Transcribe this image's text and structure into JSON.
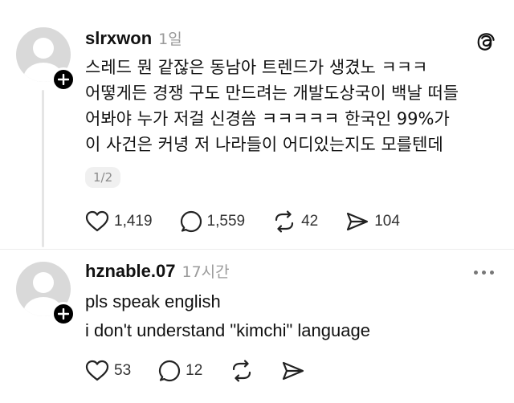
{
  "posts": [
    {
      "username": "slrxwon",
      "time": "1일",
      "lines": [
        "스레드 뭔 같잖은 동남아 트렌드가 생겼노 ㅋㅋㅋ",
        "어떻게든 경쟁 구도 만드려는 개발도상국이 백날 떠들",
        "어봐야 누가 저걸 신경씀 ㅋㅋㅋㅋㅋ 한국인 99%가",
        "이 사건은 커녕 저 나라들이 어디있는지도 모를텐데"
      ],
      "page_indicator": "1/2",
      "likes": "1,419",
      "comments": "1,559",
      "reposts": "42",
      "shares": "104"
    },
    {
      "username": "hznable.07",
      "time": "17시간",
      "lines": [
        "pls speak english",
        "i don't understand \"kimchi\" language"
      ],
      "likes": "53",
      "comments": "12"
    }
  ],
  "icons": {
    "avatar": "default-avatar",
    "follow": "plus-icon",
    "brand": "threads-icon",
    "more": "more-icon",
    "like": "heart-icon",
    "comment": "comment-icon",
    "repost": "repost-icon",
    "share": "share-icon"
  }
}
